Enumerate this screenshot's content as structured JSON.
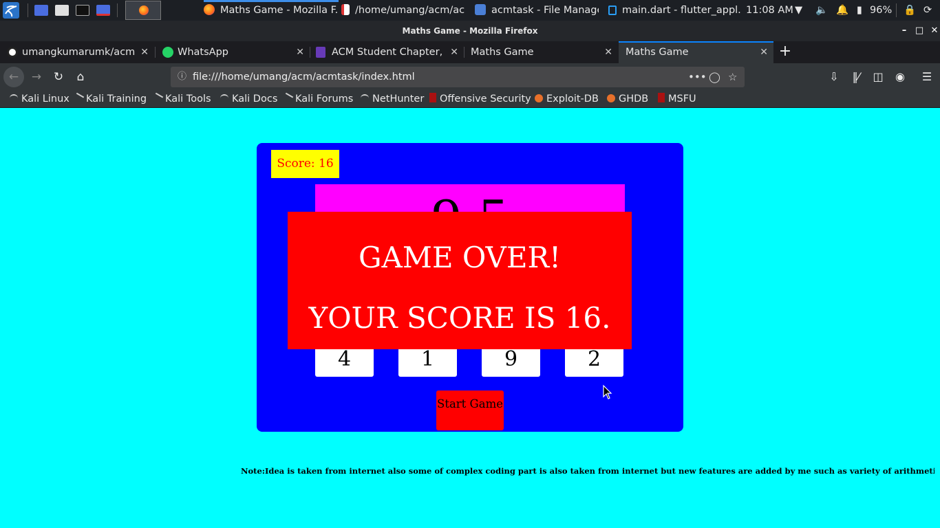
{
  "os_panel": {
    "tasks": [
      {
        "label": "Maths Game - Mozilla F...",
        "icon": "firefox-icon"
      },
      {
        "label": "/home/umang/acm/ac...",
        "icon": "file-icon"
      },
      {
        "label": "acmtask - File Manager",
        "icon": "folder-icon"
      },
      {
        "label": "main.dart - flutter_appl...",
        "icon": "vscode-icon"
      }
    ],
    "clock": "11:08 AM",
    "battery": "96%"
  },
  "window": {
    "title": "Maths Game - Mozilla Firefox"
  },
  "tabs": [
    {
      "label": "umangkumarumk/acmtask",
      "icon": "github-icon"
    },
    {
      "label": "WhatsApp",
      "icon": "whatsapp-icon"
    },
    {
      "label": "ACM Student Chapter, BIT Mesra",
      "icon": "forms-icon"
    },
    {
      "label": "Maths Game",
      "icon": ""
    },
    {
      "label": "Maths Game",
      "icon": ""
    }
  ],
  "navbar": {
    "url": "file:///home/umang/acm/acmtask/index.html"
  },
  "bookmarks": [
    {
      "label": "Kali Linux"
    },
    {
      "label": "Kali Training"
    },
    {
      "label": "Kali Tools"
    },
    {
      "label": "Kali Docs"
    },
    {
      "label": "Kali Forums"
    },
    {
      "label": "NetHunter"
    },
    {
      "label": "Offensive Security"
    },
    {
      "label": "Exploit-DB"
    },
    {
      "label": "GHDB"
    },
    {
      "label": "MSFU"
    }
  ],
  "game": {
    "score_text": "Score: 16",
    "question": "9 5",
    "choices": [
      "4",
      "1",
      "9",
      "2"
    ],
    "start_button": "Start Game",
    "gameover_line1": "GAME OVER!",
    "gameover_line2": "YOUR SCORE IS 16."
  },
  "note": "Note:Idea is taken from internet also some of complex coding part is also taken from internet but new features are added by me such as variety of arithmetic questions",
  "colors": {
    "page_bg": "#00ffff",
    "game_box": "#0000ff",
    "score_bg": "#ffff00",
    "question_bg": "#ff00ff",
    "gameover_bg": "#ff0000",
    "firefox_accent": "#0a84ff"
  }
}
